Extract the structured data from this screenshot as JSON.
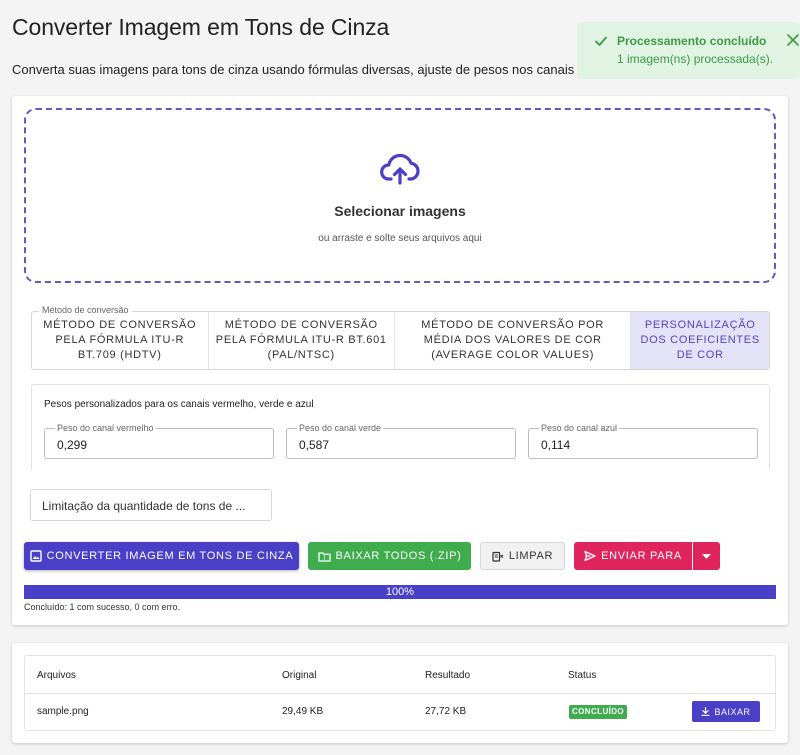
{
  "page": {
    "title": "Converter Imagem em Tons de Cinza",
    "subtitle": "Converta suas imagens para tons de cinza usando fórmulas diversas, ajuste de pesos nos canais e limitação da quantidade de tons de cinza."
  },
  "toast": {
    "title": "Processamento concluído",
    "message": "1 imagem(ns) processada(s).",
    "icon": "check-icon",
    "close_icon": "close-icon",
    "color": "#3d9a45"
  },
  "dropzone": {
    "icon": "cloud-upload-icon",
    "title": "Selecionar imagens",
    "hint": "ou arraste e solte seus arquivos aqui"
  },
  "method": {
    "legend": "Método de conversão",
    "tabs": [
      {
        "label": "MÉTODO DE CONVERSÃO PELA FÓRMULA ITU-R BT.709 (HDTV)",
        "active": false
      },
      {
        "label": "MÉTODO DE CONVERSÃO PELA FÓRMULA ITU-R BT.601 (PAL/NTSC)",
        "active": false
      },
      {
        "label": "MÉTODO DE CONVERSÃO POR MÉDIA DOS VALORES DE COR (AVERAGE COLOR VALUES)",
        "active": false
      },
      {
        "label": "PERSONALIZAÇÃO DOS COEFICIENTES DE COR",
        "active": true
      }
    ]
  },
  "weights": {
    "title": "Pesos personalizados para os canais vermelho, verde e azul",
    "red": {
      "label": "Peso do canal vermelho",
      "value": "0,299"
    },
    "green": {
      "label": "Peso do canal verde",
      "value": "0,587"
    },
    "blue": {
      "label": "Peso do canal azul",
      "value": "0,114"
    }
  },
  "limit": {
    "label": "Limitação da quantidade de tons de ..."
  },
  "actions": {
    "convert": "CONVERTER IMAGEM EM TONS DE CINZA",
    "download_all": "BAIXAR TODOS (.ZIP)",
    "clear": "LIMPAR",
    "send_to": "ENVIAR PARA",
    "colors": {
      "convert": "#4a3fc7",
      "download_all": "#3fad4e",
      "send_to": "#e0245e"
    }
  },
  "progress": {
    "percent": 100,
    "label": "100%",
    "status": "Concluído: 1 com sucesso, 0 com erro."
  },
  "files": {
    "headers": {
      "file": "Arquivos",
      "original": "Original",
      "result": "Resultado",
      "status": "Status"
    },
    "rows": [
      {
        "name": "sample.png",
        "original": "29,49 KB",
        "result": "27,72 KB",
        "status": "CONCLUÍDO",
        "action": "BAIXAR"
      }
    ]
  }
}
